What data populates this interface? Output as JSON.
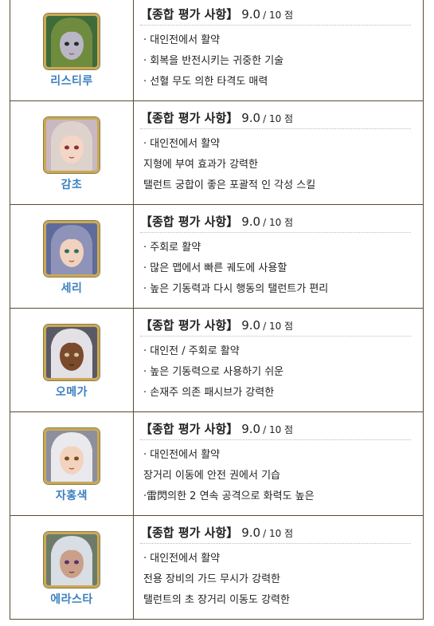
{
  "rows": [
    {
      "name": "리스티루",
      "title": "【종합 평가 사항】",
      "score": "9.0",
      "score_suffix": "/ 10 점",
      "lines": [
        "· 대인전에서 활약",
        "· 회복을 반전시키는 귀중한 기술",
        "· 선혈 무도 의한 타격도 매력"
      ],
      "colors": {
        "hair": "#6f8c3e",
        "skin": "#b9b7c6",
        "bg": "#3f6a3a"
      }
    },
    {
      "name": "감초",
      "title": "【종합 평가 사항】",
      "score": "9.0",
      "score_suffix": "/ 10 점",
      "lines": [
        "· 대인전에서 활약",
        "지형에 부여 효과가 강력한",
        "탤런트 궁합이 좋은 포괄적 인 각성 스킬"
      ],
      "colors": {
        "hair": "#ddd2cc",
        "skin": "#f4d6c6",
        "bg": "#c9b8c0"
      }
    },
    {
      "name": "세리",
      "title": "【종합 평가 사항】",
      "score": "9.0",
      "score_suffix": "/ 10 점",
      "lines": [
        "· 주회로 활약",
        "· 많은 맵에서 빠른 궤도에 사용할",
        "· 높은 기동력과 다시 행동의 탤런트가 편리"
      ],
      "colors": {
        "hair": "#8f93b9",
        "skin": "#f0d2bf",
        "bg": "#5f6b9a"
      }
    },
    {
      "name": "오메가",
      "title": "【종합 평가 사항】",
      "score": "9.0",
      "score_suffix": "/ 10 점",
      "lines": [
        "· 대인전 / 주회로 활약",
        "· 높은 기동력으로 사용하기 쉬운",
        "· 손재주 의존 패시브가 강력한"
      ],
      "colors": {
        "hair": "#e3e0e6",
        "skin": "#7a4a2c",
        "bg": "#5a5a66"
      }
    },
    {
      "name": "자홍색",
      "title": "【종합 평가 사항】",
      "score": "9.0",
      "score_suffix": "/ 10 점",
      "lines": [
        "· 대인전에서 활약",
        "장거리 이동에 안전 권에서 기습",
        "·雷閃의한 2 연속 공격으로 화력도 높은"
      ],
      "colors": {
        "hair": "#e9e9ee",
        "skin": "#f3d3bd",
        "bg": "#8d8f9c"
      }
    },
    {
      "name": "에라스타",
      "title": "【종합 평가 사항】",
      "score": "9.0",
      "score_suffix": "/ 10 점",
      "lines": [
        "· 대인전에서 활약",
        "전용 장비의 가드 무시가 강력한",
        "탤런트의 초 장거리 이동도 강력한"
      ],
      "colors": {
        "hair": "#d9dde4",
        "skin": "#caa08a",
        "bg": "#6d7b6a"
      }
    }
  ]
}
